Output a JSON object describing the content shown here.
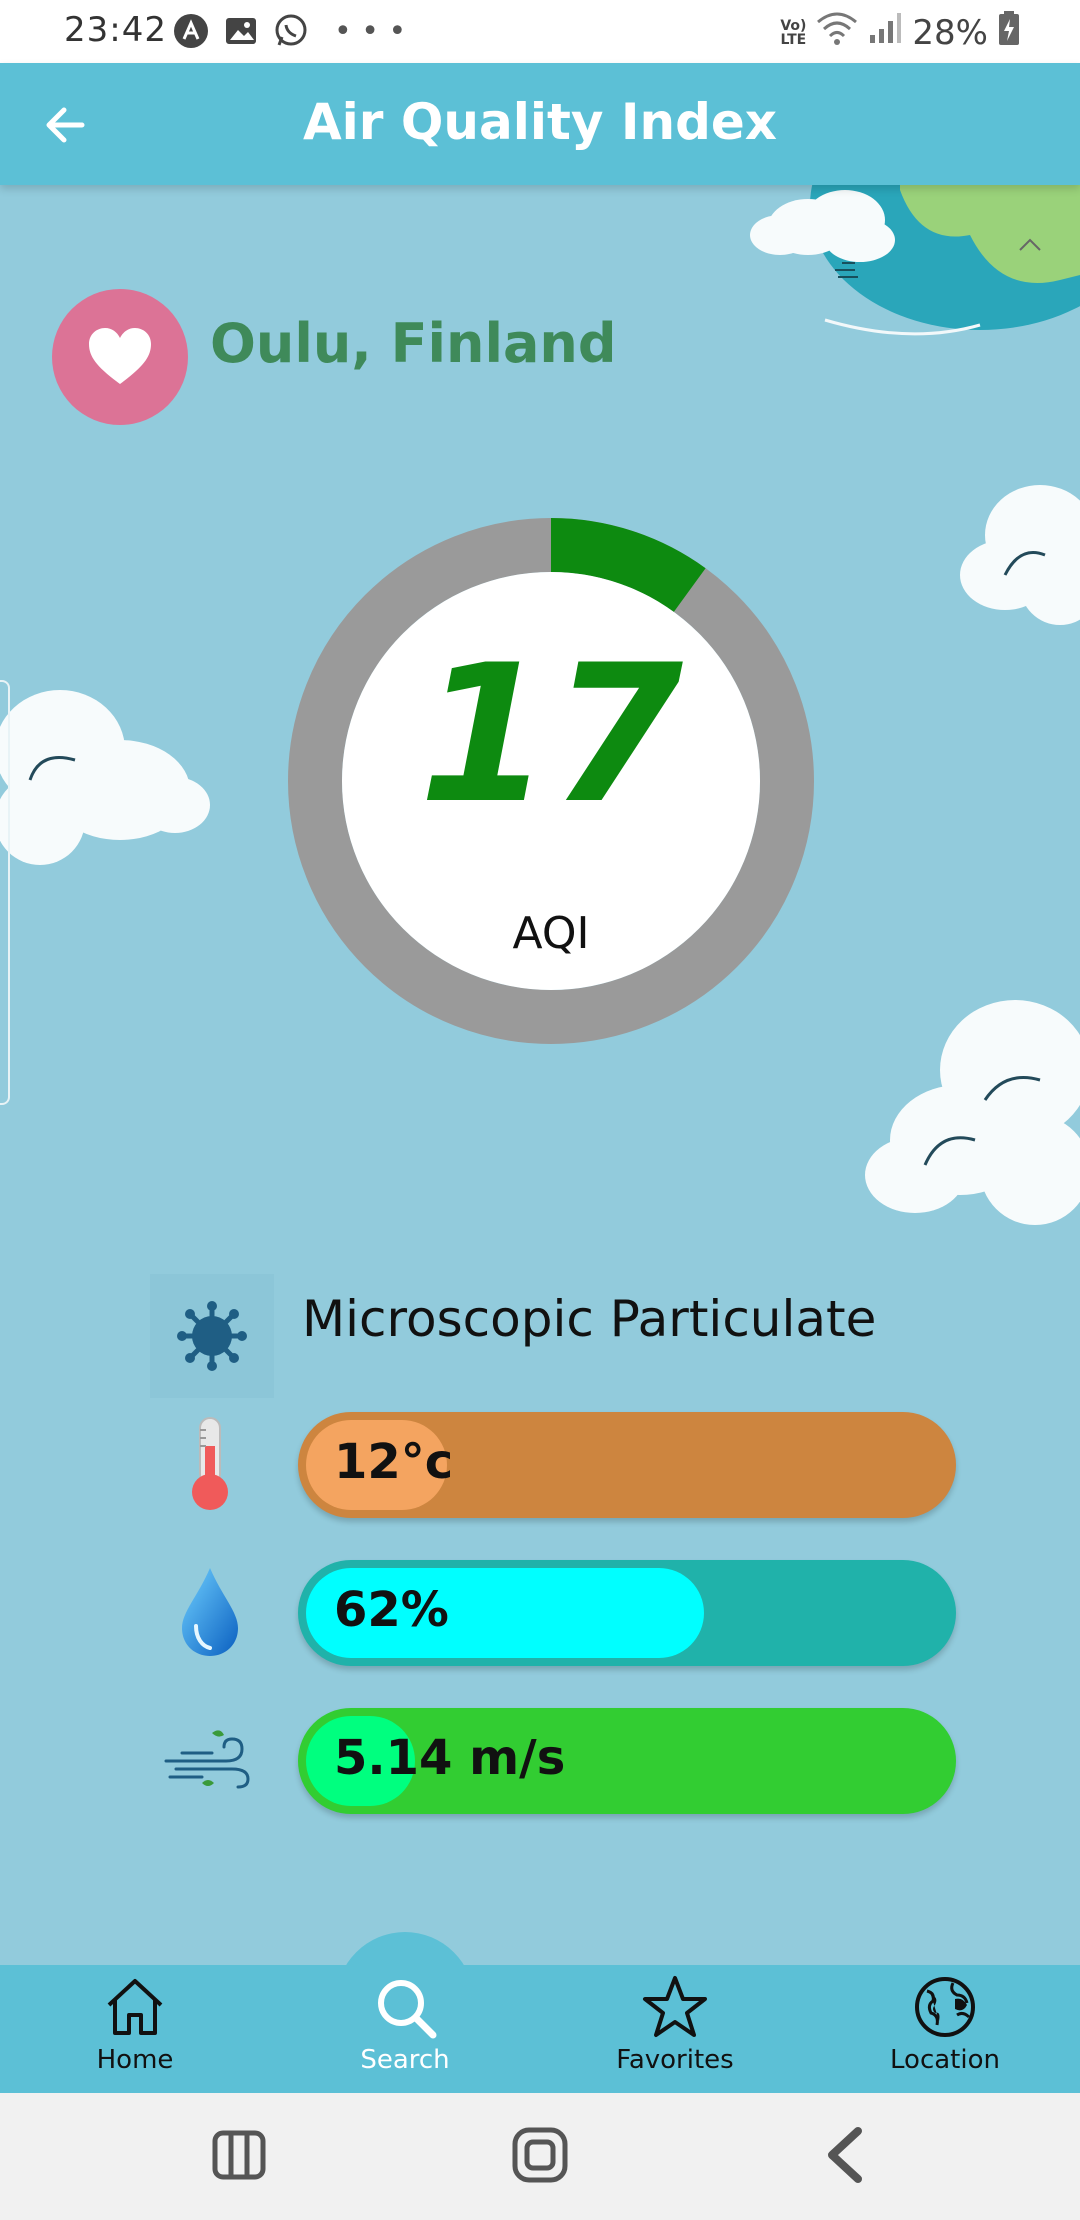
{
  "status_bar": {
    "time": "23:42",
    "battery": "28%",
    "network": "LTE"
  },
  "app_bar": {
    "title": "Air Quality Index",
    "back_icon": "arrow-left-icon"
  },
  "location": {
    "name": "Oulu, Finland",
    "favorite_icon": "heart-icon"
  },
  "aqi": {
    "value": "17",
    "label": "AQI",
    "gauge_fraction": 0.1,
    "gauge_color": "#0d8a10"
  },
  "pollutant": {
    "name": "Microscopic Particulate",
    "icon": "virus-icon"
  },
  "metrics": [
    {
      "name": "temperature",
      "icon": "thermometer-icon",
      "text": "12°c",
      "fill_fraction": 0.22,
      "bar_color": "#cd853f",
      "fill_color": "#f4a460"
    },
    {
      "name": "humidity",
      "icon": "water-drop-icon",
      "text": "62%",
      "fill_fraction": 0.62,
      "bar_color": "#20b2aa",
      "fill_color": "#00ffff"
    },
    {
      "name": "wind",
      "icon": "wind-icon",
      "text": "5.14 m/s",
      "fill_fraction": 0.17,
      "bar_color": "#32cd32",
      "fill_color": "#00ff7f"
    }
  ],
  "bottom_nav": {
    "items": [
      {
        "label": "Home",
        "icon": "home-icon"
      },
      {
        "label": "Search",
        "icon": "search-icon",
        "active": true
      },
      {
        "label": "Favorites",
        "icon": "star-icon"
      },
      {
        "label": "Location",
        "icon": "globe-icon"
      }
    ]
  },
  "system_nav": {
    "items": [
      "recents-icon",
      "home-button-icon",
      "back-chevron-icon"
    ]
  },
  "colors": {
    "background": "#92cbdc",
    "app_bar": "#5cc0d6",
    "location_text": "#3f8a5a",
    "favorite_button": "#dc7396"
  }
}
